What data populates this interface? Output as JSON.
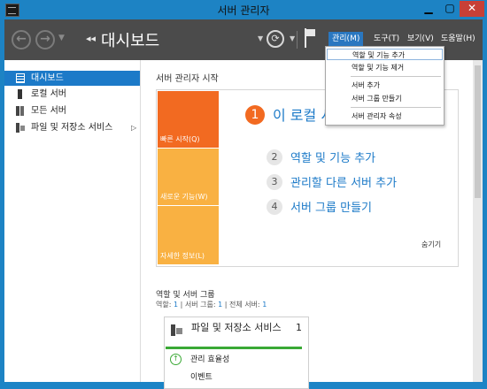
{
  "window": {
    "title": "서버 관리자",
    "min_label": "▁",
    "max_label": "▢",
    "close_label": "✕"
  },
  "toolbar": {
    "back_label": "←",
    "forward_label": "→",
    "breadcrumb_arrows": "◂◂",
    "breadcrumb": "대시보드",
    "refresh_label": "⟳",
    "menus": {
      "manage": "관리(M)",
      "tools": "도구(T)",
      "view": "보기(V)",
      "help": "도움말(H)"
    }
  },
  "sidebar": {
    "items": [
      {
        "label": "대시보드",
        "icon": "dashboard-icon"
      },
      {
        "label": "로컬 서버",
        "icon": "server-icon"
      },
      {
        "label": "모든 서버",
        "icon": "servers-icon"
      },
      {
        "label": "파일 및 저장소 서비스",
        "icon": "file-storage-icon",
        "arrow": "▷"
      }
    ]
  },
  "main": {
    "welcome_title": "서버 관리자 시작",
    "tiles": [
      "빠른 시작(Q)",
      "새로운 기능(W)",
      "자세한 정보(L)"
    ],
    "step1": {
      "num": "1",
      "text": "이 로컬 서버 구성"
    },
    "steps": [
      {
        "num": "2",
        "text": "역할 및 기능 추가"
      },
      {
        "num": "3",
        "text": "관리할 다른 서버 추가"
      },
      {
        "num": "4",
        "text": "서버 그룹 만들기"
      }
    ],
    "hide_link": "숨기기",
    "roles_title": "역할 및 서버 그룹",
    "roles_counts": {
      "roles_label": "역할: ",
      "roles": "1",
      "sep": "  |  ",
      "groups_label": "서버 그룹: ",
      "groups": "1",
      "total_label": "전체 서버: ",
      "total": "1"
    },
    "card": {
      "title": "파일 및 저장소 서비스",
      "count": "1",
      "manageability": "관리 효율성",
      "events": "이벤트",
      "up_icon": "↑"
    }
  },
  "dropdown": {
    "items": [
      "역할 및 기능 추가",
      "역할 및 기능 제거",
      "서버 추가",
      "서버 그룹 만들기",
      "서버 관리자 속성"
    ]
  },
  "colors": {
    "accent": "#1c7ac8",
    "tile_orange": "#f26a21",
    "tile_yellow": "#f9b142",
    "toolbar": "#4b4b4b",
    "window": "#1d83c4"
  }
}
